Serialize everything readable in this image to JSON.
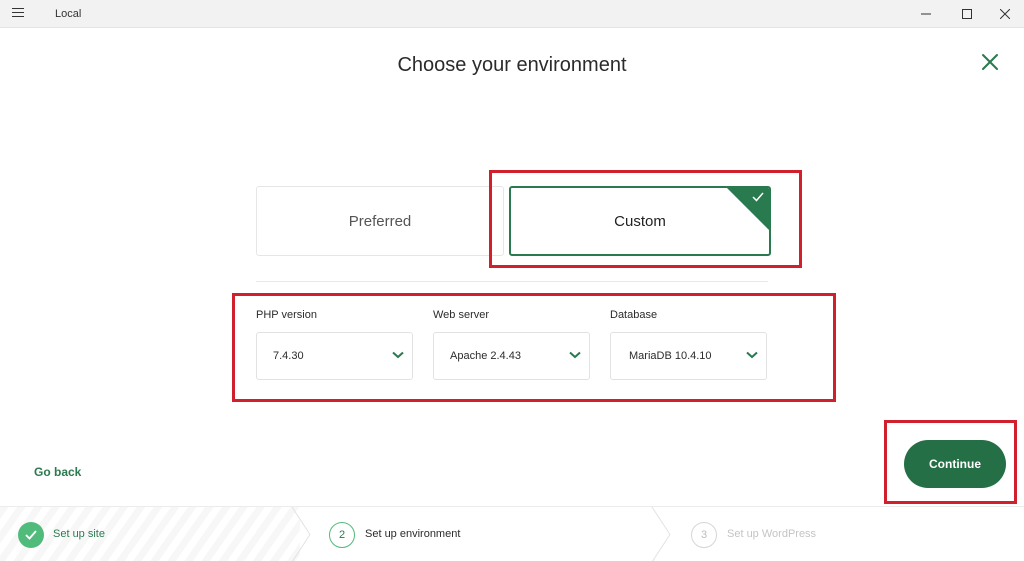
{
  "window": {
    "title": "Local"
  },
  "page": {
    "title": "Choose your environment"
  },
  "environment": {
    "options": [
      {
        "label": "Preferred",
        "selected": false
      },
      {
        "label": "Custom",
        "selected": true
      }
    ]
  },
  "fields": {
    "php": {
      "label": "PHP version",
      "value": "7.4.30"
    },
    "web_server": {
      "label": "Web server",
      "value": "Apache 2.4.43"
    },
    "database": {
      "label": "Database",
      "value": "MariaDB 10.4.10"
    }
  },
  "actions": {
    "go_back": "Go back",
    "continue": "Continue"
  },
  "steps": [
    {
      "number": "1",
      "label": "Set up site",
      "state": "complete"
    },
    {
      "number": "2",
      "label": "Set up environment",
      "state": "current"
    },
    {
      "number": "3",
      "label": "Set up WordPress",
      "state": "upcoming"
    }
  ],
  "colors": {
    "brand_green": "#246f45",
    "complete_green": "#51bb7b",
    "highlight_red": "#d0202e"
  },
  "icons": [
    "menu-icon",
    "minimize-icon",
    "maximize-icon",
    "window-close-icon",
    "close-icon",
    "checkmark-icon",
    "chevron-down-icon"
  ]
}
